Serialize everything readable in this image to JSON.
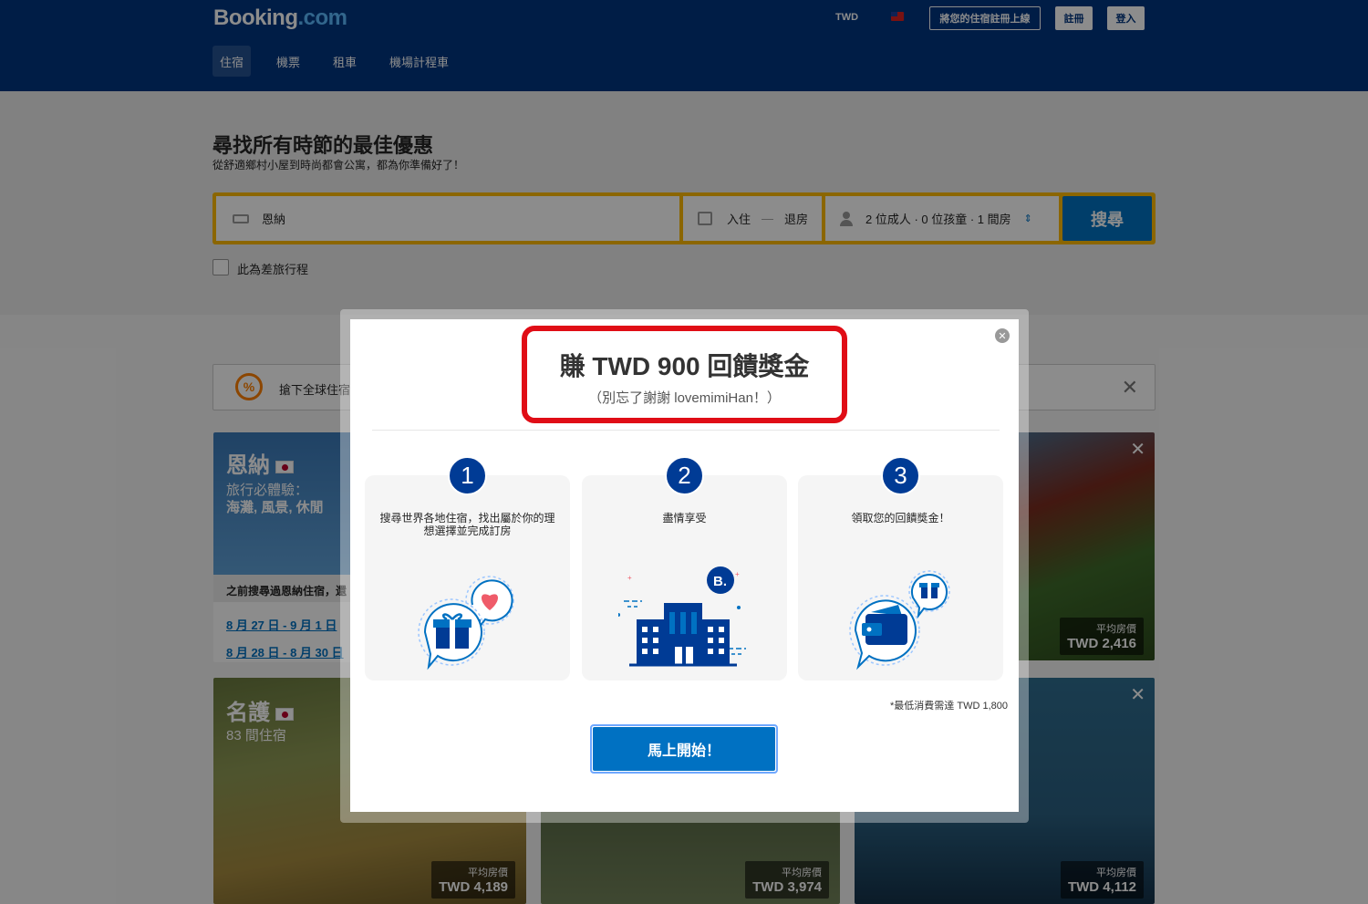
{
  "header": {
    "logo_main": "Booking",
    "logo_suffix": ".com",
    "currency": "TWD",
    "list_property": "將您的住宿註冊上線",
    "register": "註冊",
    "login": "登入",
    "nav": [
      "住宿",
      "機票",
      "租車",
      "機場計程車"
    ]
  },
  "hero": {
    "title": "尋找所有時節的最佳優惠",
    "subtitle": "從舒適鄉村小屋到時尚都會公寓，都為你準備好了！"
  },
  "search": {
    "destination": "恩納",
    "checkin": "入住",
    "dash": "—",
    "checkout": "退房",
    "guests": "2 位成人 · 0 位孩童 · 1 間房",
    "button": "搜尋",
    "business_trip": "此為差旅行程"
  },
  "promo": {
    "text": "搶下全球住宿"
  },
  "cards": {
    "enna": {
      "city": "恩納",
      "tag_line1": "旅行必體驗：",
      "tag_line2": "海灘, 風景, 休閒",
      "previous": "之前搜尋過恩納住宿，還",
      "date1": "8 月 27 日 - 9 月 1 日",
      "date2": "8 月 28 日 - 8 月 30 日"
    },
    "nago": {
      "city": "名護",
      "count": "83 間住宿",
      "price_label": "平均房價",
      "price": "TWD 4,189"
    },
    "top_right": {
      "price_label": "平均房價",
      "price": "TWD 2,416"
    },
    "bottom_middle": {
      "price_label": "平均房價",
      "price": "TWD 3,974"
    },
    "bottom_right": {
      "price_label": "平均房價",
      "price": "TWD 4,112"
    }
  },
  "modal": {
    "title": "賺 TWD 900 回饋獎金",
    "subtitle": "（別忘了謝謝 lovemimiHan！）",
    "steps": [
      {
        "num": "1",
        "text": "搜尋世界各地住宿，找出屬於你的理想選擇並完成訂房",
        "icon": "gift-heart-icon"
      },
      {
        "num": "2",
        "text": "盡情享受",
        "icon": "hotel-building-icon"
      },
      {
        "num": "3",
        "text": "領取您的回饋獎金！",
        "icon": "wallet-gift-icon"
      }
    ],
    "building_badge": "B.",
    "fine_print": "*最低消費需達 TWD 1,800",
    "cta": "馬上開始！"
  },
  "colors": {
    "brand_blue": "#003580",
    "button_blue": "#0071c2",
    "searchbar_yellow": "#febb02",
    "step_circle": "#003b95",
    "highlight_red": "#e00d16"
  }
}
